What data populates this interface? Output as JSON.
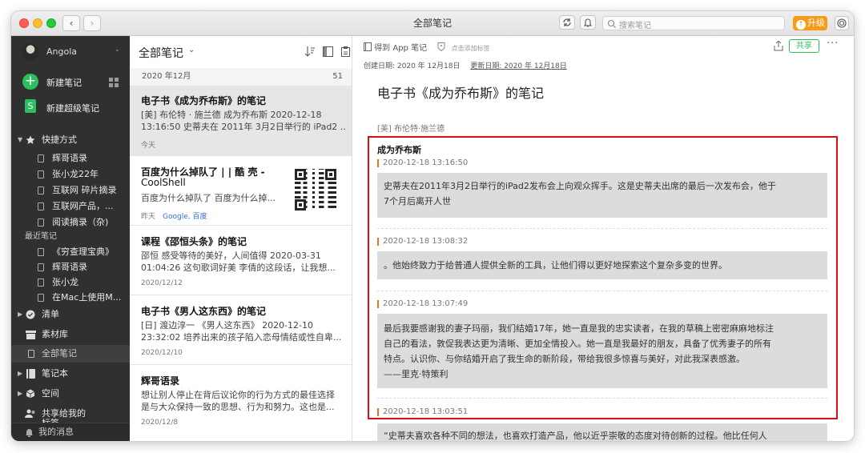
{
  "window": {
    "title": "全部笔记",
    "search_placeholder": "搜索笔记",
    "upgrade_label": "升级",
    "nav_back": "‹",
    "nav_forward": "›"
  },
  "sidebar": {
    "user_name": "Angola",
    "new_note": "新建笔记",
    "new_super_note": "新建超级笔记",
    "shortcuts_title": "快捷方式",
    "shortcuts": [
      "辉哥语录",
      "张小龙22年",
      "互联网 碎片摘录",
      "互联网产品，...",
      "阅读摘录（杂)"
    ],
    "recent_title": "最近笔记",
    "recent": [
      "《穷查理宝典》",
      "辉哥语录",
      "张小龙",
      "在Mac上使用M..."
    ],
    "checklist": "清单",
    "materials": "素材库",
    "all_notes": "全部笔记",
    "notebooks": "笔记本",
    "spaces": "空间",
    "shared_with_me": "共享给我的",
    "tags_partial": "标签",
    "messages": "我的消息"
  },
  "notelist": {
    "title": "全部笔记",
    "group_month": "2020 年12月",
    "group_count": "51",
    "notes": [
      {
        "title": "电子书《成为乔布斯》的笔记",
        "line1": "[美] 布伦特 · 施兰德 成为乔布斯 2020-12-18",
        "line2": "13:16:50 史蒂夫在 2011年 3月2日举行的 iPad2 ...",
        "date": "今天"
      },
      {
        "title": "百度为什么掉队了 | | 酷 壳 -",
        "title2": "CoolShell",
        "line1": "百度为什么掉队了 百度为什么掉...",
        "date": "昨天",
        "tags": "Google, 百度"
      },
      {
        "title": "课程《邵恒头条》的笔记",
        "line1": "邵恒 感受等待的美好，人间值得 2020-03-31",
        "line2": "01:04:26 这句歌词好美 李倩的这段话，让我想...",
        "date": "2020/12/12"
      },
      {
        "title": "电子书《男人这东西》的笔记",
        "line1": "[日] 渡边淳一 《男人这东西》 2020-12-10",
        "line2": "23:32:02 培养出来的孩子陷入恋母情结或性自卑...",
        "date": "2020/12/10"
      },
      {
        "title": "辉哥语录",
        "line1": "想让别人停止在背后议论你的行为方式的最佳选择",
        "line2": "是与大众保持一致的思想、行为和努力。这也是...",
        "date": "2020/12/8"
      }
    ]
  },
  "editor": {
    "notebook": "得到 App 笔记",
    "add_tag": "点击添加标签",
    "created": "创建日期: 2020 年 12月18日",
    "updated": "更新日期: 2020 年 12月18日",
    "share_label": "共享",
    "more_label": "···",
    "title": "电子书《成为乔布斯》的笔记",
    "author": "[美] 布伦特·施兰德",
    "section_title": "成为乔布斯",
    "highlights": [
      {
        "time": "2020-12-18 13:16:50",
        "lines": [
          "史蒂夫在2011年3月2日举行的iPad2发布会上向观众挥手。这是史蒂夫出席的最后一次发布会，他于",
          "7个月后离开人世"
        ]
      },
      {
        "time": "2020-12-18 13:08:32",
        "lines": [
          "。他始终致力于给普通人提供全新的工具，让他们得以更好地探索这个复杂多变的世界。"
        ]
      },
      {
        "time": "2020-12-18 13:07:49",
        "lines": [
          "最后我要感谢我的妻子玛丽，我们结婚17年，她一直是我的忠实读者，在我的草稿上密密麻麻地标注",
          "自己的看法，敦促我表达更为清晰、更加全情投入。她一直是我最好的朋友，具备了优秀妻子的所有",
          "特点。认识你、与你结婚开启了我生命的新阶段，带给我很多惊喜与美好，对此我深表感激。",
          "——里克·特策利"
        ]
      },
      {
        "time": "2020-12-18 13:03:51",
        "lines": [
          "“史蒂夫喜欢各种不同的想法，也喜欢打造产品，他以近乎崇敬的态度对待创新的过程。他比任何人"
        ]
      }
    ]
  },
  "colors": {
    "accent_green": "#2dbe60",
    "upgrade_orange": "#f59c1a",
    "highlight_box_red": "#d9101a",
    "sidebar_bg": "#303030",
    "timestamp_marker": "#e8741c"
  }
}
